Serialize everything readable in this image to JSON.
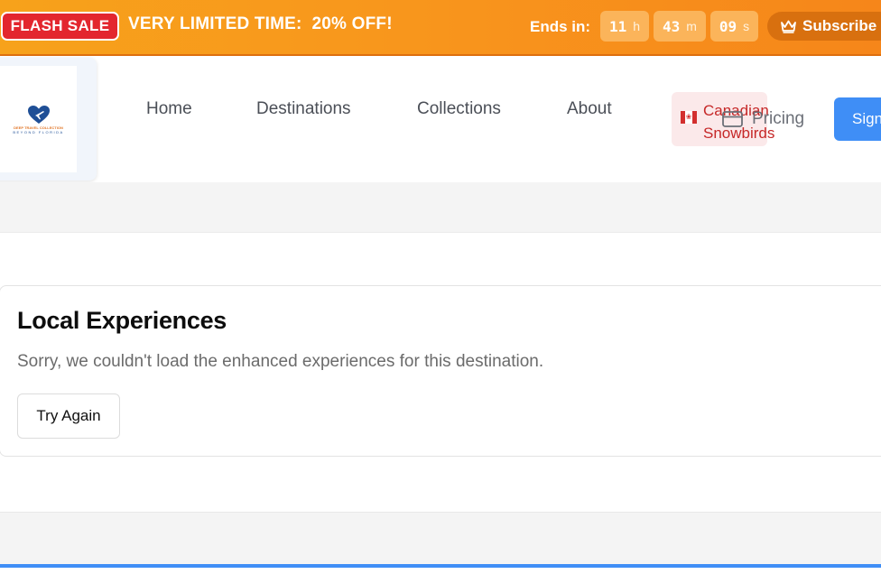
{
  "promo": {
    "badge": "FLASH SALE",
    "text": "VERY LIMITED TIME:  20% OFF!",
    "ends_label": "Ends in:",
    "countdown": [
      {
        "value": "11",
        "unit": "h"
      },
      {
        "value": "43",
        "unit": "m"
      },
      {
        "value": "09",
        "unit": "s"
      }
    ],
    "subscribe_label": "Subscribe",
    "icons": {
      "subscribe": "crown-icon"
    }
  },
  "header": {
    "logo": {
      "line1": "DEEP TRAVEL COLLECTION",
      "line2": "BEYOND FLORIDA"
    },
    "nav": [
      {
        "label": "Home"
      },
      {
        "label": "Destinations"
      },
      {
        "label": "Collections"
      },
      {
        "label": "About"
      }
    ],
    "promo_link": {
      "label_line1": "Canadian",
      "label_line2": "Snowbirds",
      "icon": "canada-flag-icon"
    },
    "pricing": {
      "label": "Pricing",
      "icon": "credit-card-icon"
    },
    "signin_label": "Sign"
  },
  "main": {
    "experiences": {
      "title": "Local Experiences",
      "message": "Sorry, we couldn't load the enhanced experiences for this destination.",
      "retry_label": "Try Again"
    }
  },
  "colors": {
    "promo_orange": "#f8951c",
    "flash_red": "#e3262e",
    "brand_blue": "#3f8ef6",
    "snowbird_red": "#c62828"
  }
}
